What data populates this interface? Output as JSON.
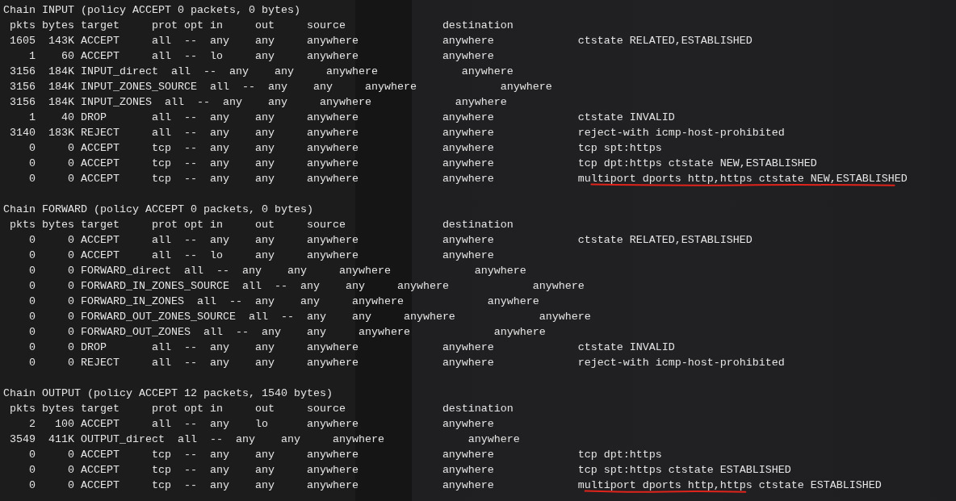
{
  "chains": [
    {
      "title": "Chain INPUT (policy ACCEPT 0 packets, 0 bytes)",
      "header": " pkts bytes target     prot opt in     out     source               destination",
      "rules": [
        {
          "line": " 1605  143K ACCEPT     all  --  any    any     anywhere             anywhere",
          "match": [
            {
              "text": "ctstate RELATED,ESTABLISHED",
              "underlined": false
            }
          ]
        },
        {
          "line": "    1    60 ACCEPT     all  --  lo     any     anywhere             anywhere"
        },
        {
          "line": " 3156  184K INPUT_direct  all  --  any    any     anywhere             anywhere"
        },
        {
          "line": " 3156  184K INPUT_ZONES_SOURCE  all  --  any    any     anywhere             anywhere"
        },
        {
          "line": " 3156  184K INPUT_ZONES  all  --  any    any     anywhere             anywhere"
        },
        {
          "line": "    1    40 DROP       all  --  any    any     anywhere             anywhere",
          "match": [
            {
              "text": "ctstate INVALID",
              "underlined": false
            }
          ]
        },
        {
          "line": " 3140  183K REJECT     all  --  any    any     anywhere             anywhere",
          "match": [
            {
              "text": "reject-with icmp-host-prohibited",
              "underlined": false
            }
          ]
        },
        {
          "line": "    0     0 ACCEPT     tcp  --  any    any     anywhere             anywhere",
          "match": [
            {
              "text": "tcp spt:https",
              "underlined": false
            }
          ]
        },
        {
          "line": "    0     0 ACCEPT     tcp  --  any    any     anywhere             anywhere",
          "match": [
            {
              "text": "tcp dpt:https ctstate NEW,ESTABLISHED",
              "underlined": false
            }
          ]
        },
        {
          "line": "    0     0 ACCEPT     tcp  --  any    any     anywhere             anywhere",
          "match": [
            {
              "text": "multiport dports http,https ctstate NEW,ESTABLISHED",
              "underlined": true
            }
          ]
        }
      ]
    },
    {
      "title": "Chain FORWARD (policy ACCEPT 0 packets, 0 bytes)",
      "header": " pkts bytes target     prot opt in     out     source               destination",
      "rules": [
        {
          "line": "    0     0 ACCEPT     all  --  any    any     anywhere             anywhere",
          "match": [
            {
              "text": "ctstate RELATED,ESTABLISHED",
              "underlined": false
            }
          ]
        },
        {
          "line": "    0     0 ACCEPT     all  --  lo     any     anywhere             anywhere"
        },
        {
          "line": "    0     0 FORWARD_direct  all  --  any    any     anywhere             anywhere"
        },
        {
          "line": "    0     0 FORWARD_IN_ZONES_SOURCE  all  --  any    any     anywhere             anywhere"
        },
        {
          "line": "    0     0 FORWARD_IN_ZONES  all  --  any    any     anywhere             anywhere"
        },
        {
          "line": "    0     0 FORWARD_OUT_ZONES_SOURCE  all  --  any    any     anywhere             anywhere"
        },
        {
          "line": "    0     0 FORWARD_OUT_ZONES  all  --  any    any     anywhere             anywhere"
        },
        {
          "line": "    0     0 DROP       all  --  any    any     anywhere             anywhere",
          "match": [
            {
              "text": "ctstate INVALID",
              "underlined": false
            }
          ]
        },
        {
          "line": "    0     0 REJECT     all  --  any    any     anywhere             anywhere",
          "match": [
            {
              "text": "reject-with icmp-host-prohibited",
              "underlined": false
            }
          ]
        }
      ]
    },
    {
      "title": "Chain OUTPUT (policy ACCEPT 12 packets, 1540 bytes)",
      "header": " pkts bytes target     prot opt in     out     source               destination",
      "rules": [
        {
          "line": "    2   100 ACCEPT     all  --  any    lo      anywhere             anywhere"
        },
        {
          "line": " 3549  411K OUTPUT_direct  all  --  any    any     anywhere             anywhere"
        },
        {
          "line": "    0     0 ACCEPT     tcp  --  any    any     anywhere             anywhere",
          "match": [
            {
              "text": "tcp dpt:https",
              "underlined": false
            }
          ]
        },
        {
          "line": "    0     0 ACCEPT     tcp  --  any    any     anywhere             anywhere",
          "match": [
            {
              "text": "tcp spt:https ctstate ESTABLISHED",
              "underlined": false
            }
          ]
        },
        {
          "line": "    0     0 ACCEPT     tcp  --  any    any     anywhere             anywhere",
          "match": [
            {
              "text": "multiport dports http,https",
              "underlined": true
            },
            {
              "text": "ctstate ESTABLISHED",
              "underlined": false
            }
          ]
        }
      ]
    }
  ]
}
